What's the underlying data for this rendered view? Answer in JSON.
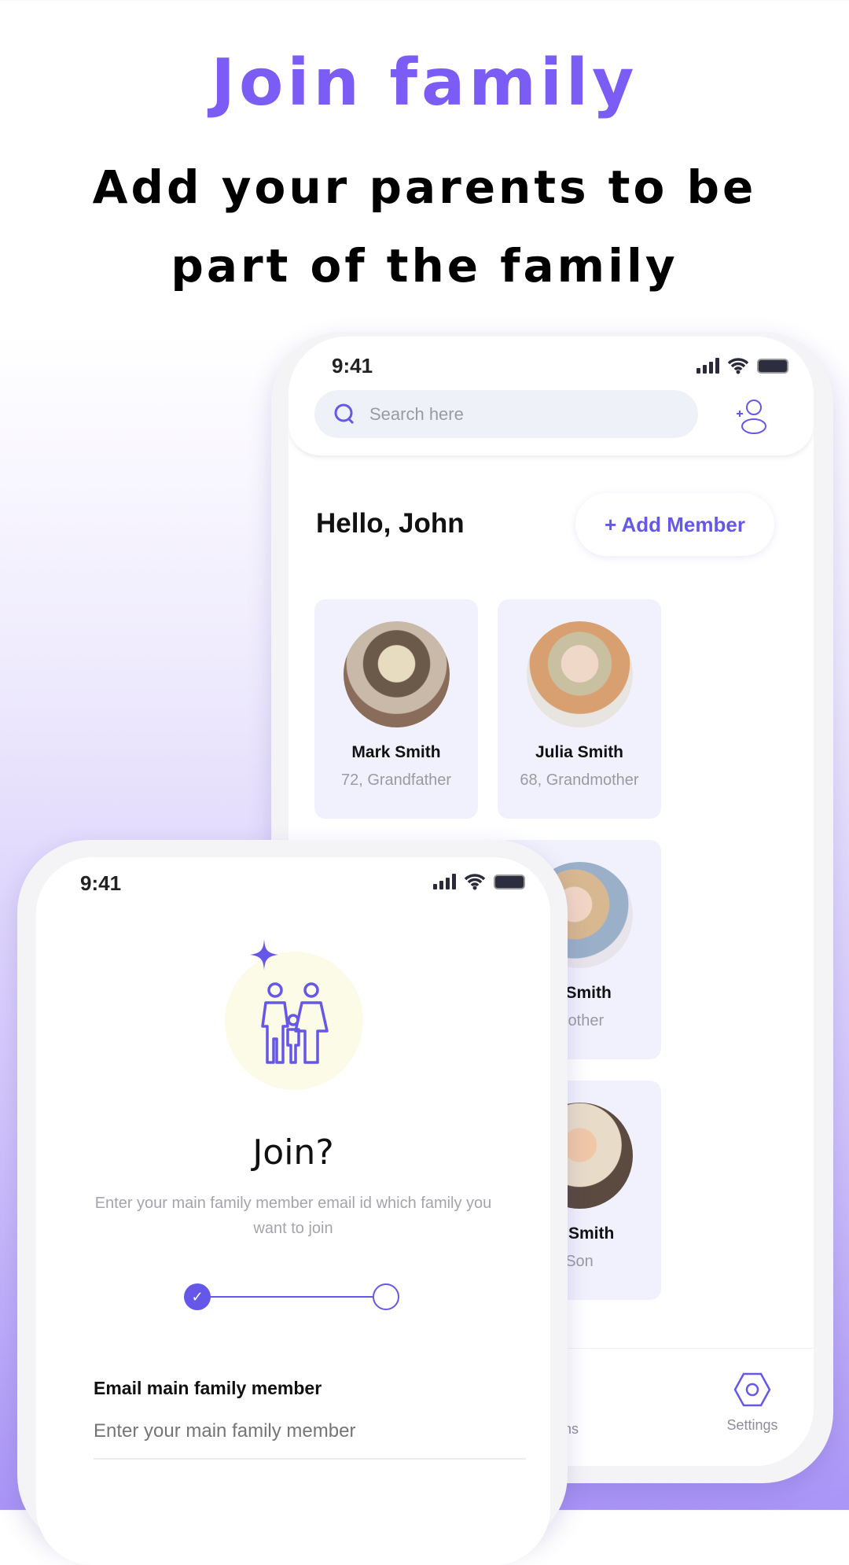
{
  "headline": {
    "title": "Join family",
    "subtitle": "Add your parents to be part of the family"
  },
  "colors": {
    "accent": "#6558e8",
    "title": "#7b5cf5"
  },
  "back_phone": {
    "status_time": "9:41",
    "search_placeholder": "Search here",
    "greeting": "Hello, John",
    "add_member": "+ Add Member",
    "members": [
      {
        "name": "Mark Smith",
        "detail": "72, Grandfather"
      },
      {
        "name": "Julia Smith",
        "detail": "68, Grandmother"
      },
      {
        "name": "el Smith",
        "detail": "Mother"
      },
      {
        "name": "us Smith",
        "detail": "Son"
      }
    ],
    "nav": {
      "partial_label": "ons",
      "settings": "Settings"
    }
  },
  "front_phone": {
    "status_time": "9:41",
    "heading": "Join?",
    "description": "Enter your main family member email id which family you want to join",
    "progress_step": 1,
    "progress_total": 2,
    "email_label": "Email main family member",
    "email_placeholder": "Enter your main family member"
  }
}
